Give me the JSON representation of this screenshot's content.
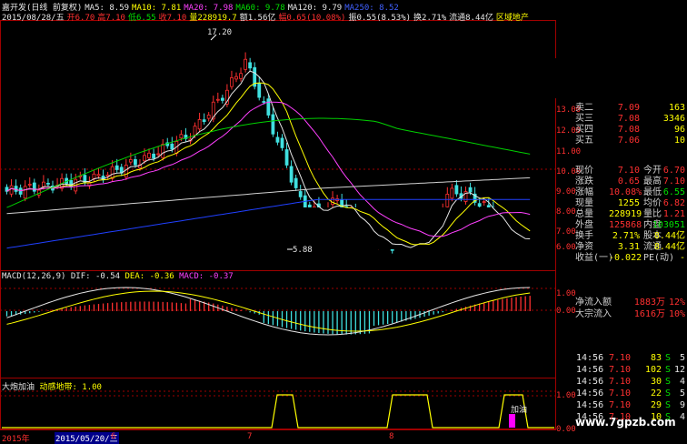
{
  "header": {
    "name": "嘉开发(日线 前复权)",
    "ma5": "MA5: 8.59",
    "ma10": "MA10: 7.81",
    "ma20": "MA20: 7.98",
    "ma60": "MA60: 9.78",
    "ma120": "MA120: 9.79",
    "ma250": "MA250: 8.52"
  },
  "info": {
    "date": "2015/08/28/五",
    "open": "开6.70",
    "high": "高7.10",
    "low": "低6.55",
    "close": "收7.10",
    "volume": "量228919.7",
    "amount": "额1.56亿",
    "change": "幅0.65(10.08%)",
    "amp": "振0.55(8.53%)",
    "turnover": "换2.71%",
    "float": "流通8.44亿",
    "sector": "区域地产"
  },
  "annotations": {
    "high": "17.20",
    "low": "5.88"
  },
  "price_axis": [
    "13.00",
    "12.00",
    "11.00",
    "10.00",
    "9.00",
    "8.00",
    "7.00",
    "6.00"
  ],
  "macd_axis": [
    "1.00",
    "0.00"
  ],
  "signal_axis": [
    "1.00",
    "0.00"
  ],
  "macd_label": {
    "name": "MACD(12,26,9)",
    "dif": "DIF: -0.54",
    "dea": "DEA: -0.36",
    "macd": "MACD: -0.37"
  },
  "signal_label": {
    "name": "大炮加油",
    "sub": "动感地带: 1.00",
    "tag": "加油"
  },
  "time_axis": {
    "y2015": "2015年",
    "date": "2015/05/20/三",
    "m6": "6",
    "m7": "7",
    "m8": "8"
  },
  "watermark": "www.7gpzb.com",
  "quote": {
    "asks": [
      {
        "label": "卖二",
        "price": "7.09",
        "vol": "163"
      },
      {
        "label": "买三",
        "price": "7.08",
        "vol": "3346"
      },
      {
        "label": "买四",
        "price": "7.08",
        "vol": "96"
      },
      {
        "label": "买五",
        "price": "7.06",
        "vol": "10"
      }
    ],
    "rows": [
      {
        "l": "现价",
        "v": "7.10",
        "l2": "今开",
        "v2": "6.70"
      },
      {
        "l": "涨跌",
        "v": "0.65",
        "l2": "最高",
        "v2": "7.10"
      },
      {
        "l": "涨幅",
        "v": "10.08%",
        "l2": "最低",
        "v2": "6.55"
      },
      {
        "l": "现量",
        "v": "1255",
        "l2": "均价",
        "v2": "6.82"
      },
      {
        "l": "总量",
        "v": "228919",
        "l2": "量比",
        "v2": "1.21"
      },
      {
        "l": "外盘",
        "v": "125868",
        "l2": "内盘",
        "v2": "103051"
      },
      {
        "l": "换手",
        "v": "2.71%",
        "l2": "股本",
        "v2": "8.44亿"
      },
      {
        "l": "净资",
        "v": "3.31",
        "l2": "流通",
        "v2": "8.44亿"
      },
      {
        "l": "收益(一)",
        "v": "-0.022",
        "l2": "PE(动)",
        "v2": "-"
      }
    ],
    "flows": [
      {
        "l": "净流入额",
        "v": "1883万",
        "p": "12%"
      },
      {
        "l": "大宗流入",
        "v": "1616万",
        "p": "10%"
      }
    ],
    "trades": [
      {
        "t": "14:56",
        "p": "7.10",
        "v": "83",
        "s": "S",
        "n": "5"
      },
      {
        "t": "14:56",
        "p": "7.10",
        "v": "102",
        "s": "S",
        "n": "12"
      },
      {
        "t": "14:56",
        "p": "7.10",
        "v": "30",
        "s": "S",
        "n": "4"
      },
      {
        "t": "14:56",
        "p": "7.10",
        "v": "22",
        "s": "S",
        "n": "5"
      },
      {
        "t": "14:56",
        "p": "7.10",
        "v": "29",
        "s": "S",
        "n": "9"
      },
      {
        "t": "14:56",
        "p": "7.10",
        "v": "10",
        "s": "S",
        "n": "4"
      }
    ]
  },
  "colors": {
    "up": "#ff3030",
    "down": "#40e0e0",
    "ma5": "#e6e6e6",
    "ma10": "#ffff00",
    "ma20": "#ff40ff",
    "ma60": "#00d000",
    "ma120": "#d0d0d0",
    "ma250": "#2040ff"
  }
}
